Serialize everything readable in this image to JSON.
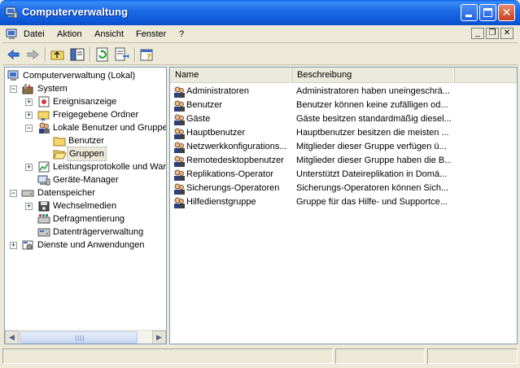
{
  "window": {
    "title": "Computerverwaltung",
    "title_color": "#0a5ee6",
    "icon": "computer-management-icon",
    "controls": {
      "minimize": "minimize-icon",
      "maximize": "maximize-icon",
      "close": "✕"
    }
  },
  "menu": {
    "items": [
      {
        "label": "Datei"
      },
      {
        "label": "Aktion"
      },
      {
        "label": "Ansicht"
      },
      {
        "label": "Fenster"
      },
      {
        "label": "?"
      }
    ],
    "mdi": {
      "minimize": "_",
      "restore": "❐",
      "close": "✕"
    }
  },
  "toolbar": {
    "buttons": [
      "back-icon",
      "forward-icon",
      "up-folder-icon",
      "show-hide-tree-icon",
      "refresh-icon",
      "export-list-icon",
      "properties-help-icon"
    ]
  },
  "tree": {
    "items": [
      {
        "label": "Computerverwaltung (Lokal)",
        "icon": "computer-management-icon"
      },
      {
        "label": "System",
        "icon": "system-tools-icon"
      },
      {
        "label": "Ereignisanzeige",
        "icon": "event-viewer-icon"
      },
      {
        "label": "Freigegebene Ordner",
        "icon": "shared-folder-icon"
      },
      {
        "label": "Lokale Benutzer und Gruppen",
        "icon": "users-groups-icon"
      },
      {
        "label": "Benutzer",
        "icon": "folder-icon"
      },
      {
        "label": "Gruppen",
        "icon": "folder-open-icon"
      },
      {
        "label": "Leistungsprotokolle und Warnungen",
        "icon": "performance-logs-icon"
      },
      {
        "label": "Geräte-Manager",
        "icon": "device-manager-icon"
      },
      {
        "label": "Datenspeicher",
        "icon": "storage-icon"
      },
      {
        "label": "Wechselmedien",
        "icon": "removable-storage-icon"
      },
      {
        "label": "Defragmentierung",
        "icon": "defrag-icon"
      },
      {
        "label": "Datenträgerverwaltung",
        "icon": "disk-management-icon"
      },
      {
        "label": "Dienste und Anwendungen",
        "icon": "services-applications-icon"
      }
    ]
  },
  "list": {
    "columns": [
      "Name",
      "Beschreibung"
    ],
    "rows": [
      {
        "name": "Administratoren",
        "desc": "Administratoren haben uneingeschrä..."
      },
      {
        "name": "Benutzer",
        "desc": "Benutzer können keine zufälligen od..."
      },
      {
        "name": "Gäste",
        "desc": "Gäste besitzen standardmäßig diesel..."
      },
      {
        "name": "Hauptbenutzer",
        "desc": "Hauptbenutzer besitzen die meisten ..."
      },
      {
        "name": "Netzwerkkonfigurations...",
        "desc": "Mitglieder dieser Gruppe verfügen ü..."
      },
      {
        "name": "Remotedesktopbenutzer",
        "desc": "Mitglieder dieser Gruppe haben die B..."
      },
      {
        "name": "Replikations-Operator",
        "desc": "Unterstützt Dateireplikation in Domä..."
      },
      {
        "name": "Sicherungs-Operatoren",
        "desc": "Sicherungs-Operatoren können Sich..."
      },
      {
        "name": "Hilfedienstgruppe",
        "desc": "Gruppe für das Hilfe- und Supportce..."
      }
    ]
  },
  "statusbar": {
    "panels": [
      "",
      "",
      ""
    ]
  }
}
